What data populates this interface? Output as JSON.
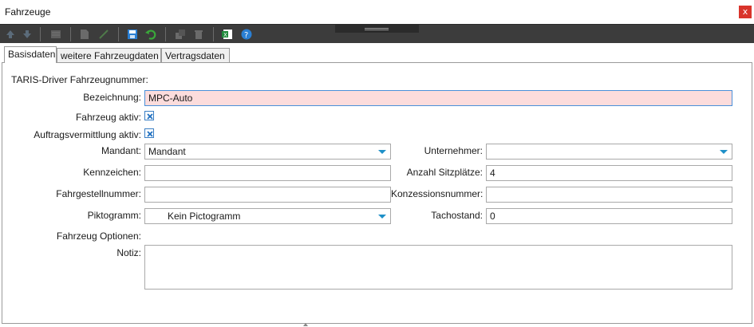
{
  "window": {
    "title": "Fahrzeuge",
    "close_label": "x"
  },
  "toolbar": {
    "icons": [
      "arrow-up-icon",
      "arrow-down-icon",
      "list-icon",
      "new-document-icon",
      "edit-icon",
      "save-icon",
      "undo-icon",
      "copy-icon",
      "delete-icon",
      "export-excel-icon",
      "help-icon"
    ]
  },
  "tabs": [
    {
      "label": "Basisdaten",
      "active": true
    },
    {
      "label": "weitere Fahrzeugdaten",
      "active": false
    },
    {
      "label": "Vertragsdaten",
      "active": false
    }
  ],
  "form": {
    "taris_label": "TARIS-Driver Fahrzeugnummer:",
    "bezeichnung_label": "Bezeichnung:",
    "bezeichnung_value": "MPC-Auto",
    "aktiv_label": "Fahrzeug aktiv:",
    "aktiv_checked": true,
    "auftrag_label": "Auftragsvermittlung aktiv:",
    "auftrag_checked": true,
    "mandant_label": "Mandant:",
    "mandant_value": "Mandant",
    "unternehmer_label": "Unternehmer:",
    "unternehmer_value": "",
    "kennzeichen_label": "Kennzeichen:",
    "kennzeichen_value": "",
    "sitzplaetze_label": "Anzahl Sitzplätze:",
    "sitzplaetze_value": "4",
    "fahrgestell_label": "Fahrgestellnummer:",
    "fahrgestell_value": "",
    "konzession_label": "Konzessionsnummer:",
    "konzession_value": "",
    "piktogramm_label": "Piktogramm:",
    "piktogramm_value": "Kein Pictogramm",
    "tachostand_label": "Tachostand:",
    "tachostand_value": "0",
    "optionen_label": "Fahrzeug Optionen:",
    "notiz_label": "Notiz:",
    "notiz_value": ""
  },
  "colors": {
    "toolbar_bg": "#3c3c3c",
    "close_bg": "#d9342b",
    "error_bg": "#fcdcdc",
    "accent": "#1e90c8"
  }
}
